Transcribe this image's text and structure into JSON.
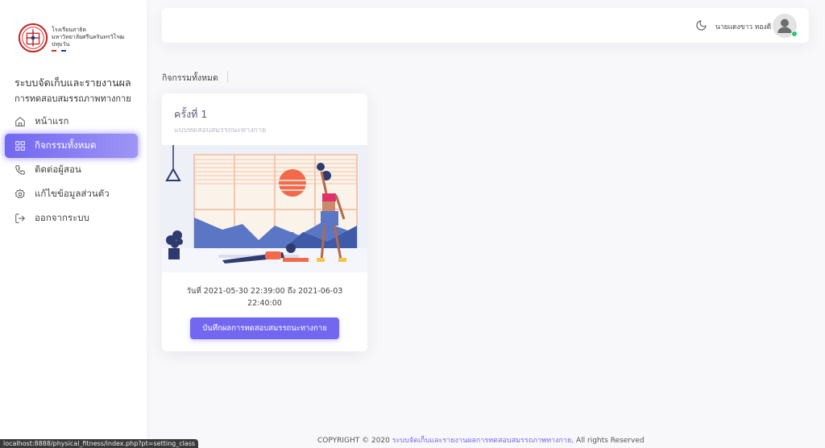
{
  "logo": {
    "line1": "โรงเรียนสาธิต",
    "line2": "มหาวิทยาลัยศรีนครินทรวิโรฒ",
    "line3": "ปทุมวัน"
  },
  "sidebar": {
    "title": "ระบบจัดเก็บและรายงานผล",
    "subtitle": "การทดสอบสมรรถภาพทางกาย",
    "items": [
      {
        "label": "หน้าแรก",
        "icon": "home-icon"
      },
      {
        "label": "กิจกรรมทั้งหมด",
        "icon": "grid-icon",
        "active": true
      },
      {
        "label": "ติดต่อผู้สอน",
        "icon": "phone-icon"
      },
      {
        "label": "แก้ไขข้อมูลส่วนตัว",
        "icon": "settings-icon"
      },
      {
        "label": "ออกจากระบบ",
        "icon": "logout-icon"
      }
    ]
  },
  "navbar": {
    "username": "นายแดงขาว ทองดี",
    "theme_icon": "moon-icon"
  },
  "breadcrumb": "กิจกรรมทั้งหมด",
  "activity_card": {
    "title": "ครั้งที่ 1",
    "subtitle": "แบบทดสอบสมรรถนะทางกาย",
    "date_text": "วันที่ 2021-05-30 22:39:00 ถึง 2021-06-03 22:40:00",
    "button_label": "บันทึกผลการทดสอบสมรรถนะทางกาย"
  },
  "footer": {
    "prefix": "COPYRIGHT © 2020",
    "link_text": "ระบบจัดเก็บและรายงานผลการทดสอบสมรรถภาพทางกาย,",
    "suffix": "All rights Reserved"
  },
  "status_bar": "localhost:8888/physical_fitness/index.php?pt=setting_class",
  "colors": {
    "primary": "#7367f0",
    "online": "#28c76f",
    "background": "#f8f7fa"
  }
}
